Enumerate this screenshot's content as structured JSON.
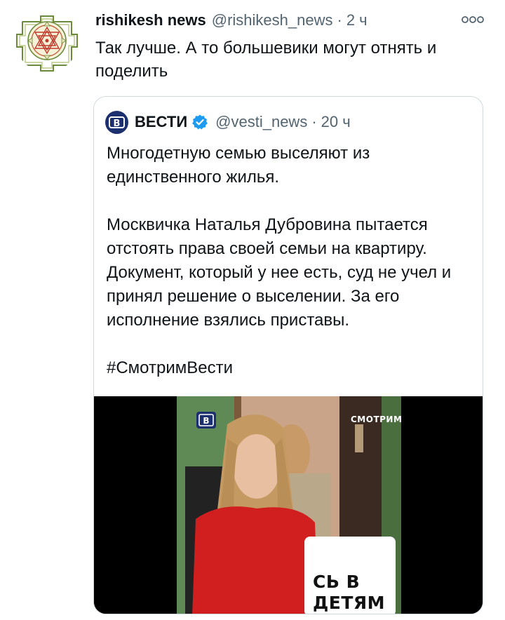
{
  "tweet": {
    "author_name": "rishikesh news",
    "author_handle": "@rishikesh_news",
    "separator": "·",
    "time": "2 ч",
    "text": "Так лучше. А то большевики могут отнять и поделить",
    "more_icon": "more-dots-icon"
  },
  "quoted": {
    "author_name": "ВЕСТИ",
    "author_handle": "@vesti_news",
    "separator": "·",
    "time": "20 ч",
    "avatar_letter": "В",
    "paragraph1": "Многодетную семью выселяют из единственного жилья.",
    "paragraph2": "Москвичка Наталья Дубровина пытается отстоять права своей семьи на квартиру. Документ, который у нее есть, суд не учел и принял решение о выселении. За его исполнение взялись приставы.",
    "hashtag": "#СмотримВести",
    "media": {
      "channel_logo": "В",
      "watermark": "СМОТРИМ",
      "caption_line1": "СЬ В",
      "caption_line2": "ДЕТЯМ"
    }
  },
  "colors": {
    "text": "#0f1419",
    "secondary": "#536471",
    "border": "#cfd9de",
    "verified": "#1d9bf0",
    "vesti_blue": "#1c2f6f"
  }
}
